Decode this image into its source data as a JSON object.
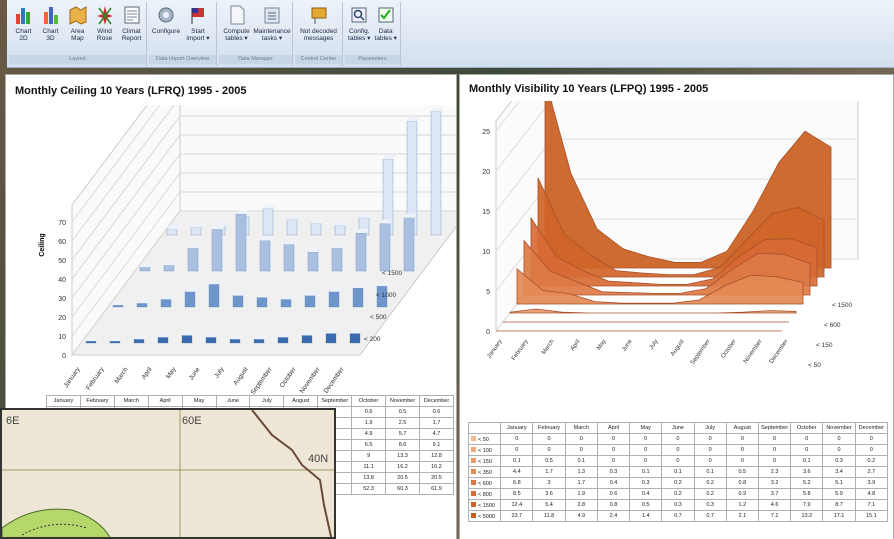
{
  "ribbon": {
    "groups": [
      {
        "caption": "Layout",
        "buttons": [
          "Chart\n2D",
          "Chart\n3D",
          "Area\nMap",
          "Wind\nRose",
          "Climat\nReport"
        ]
      },
      {
        "caption": "Data Import Overview",
        "buttons": [
          "Configure",
          "Start\nimport ▾"
        ]
      },
      {
        "caption": "Data Manager",
        "buttons": [
          "Compute\ntables ▾",
          "Maintenance\ntasks ▾"
        ]
      },
      {
        "caption": "Control Center",
        "buttons": [
          "Not decoded\nmessages"
        ]
      },
      {
        "caption": "Parameters",
        "buttons": [
          "Config.\ntables ▾",
          "Data\ntables ▾"
        ]
      }
    ]
  },
  "ceiling": {
    "title": "Monthly Ceiling 10 Years (LFRQ) 1995 - 2005",
    "ylabel": "Ceiling",
    "yticks": [
      "0",
      "10",
      "20",
      "30",
      "40",
      "50",
      "60",
      "70"
    ],
    "depth_labels": [
      "< 1500",
      "< 1000",
      "< 500",
      "< 200"
    ],
    "months": [
      "January",
      "February",
      "March",
      "April",
      "May",
      "June",
      "July",
      "August",
      "September",
      "October",
      "November",
      "December"
    ],
    "table_rows": [
      [
        "",
        "",
        "",
        "",
        "",
        "",
        "",
        "",
        "0.6",
        "0.5",
        "0.6"
      ],
      [
        "",
        "",
        "",
        "",
        "",
        "",
        "",
        "",
        "1.9",
        "2.5",
        "1.7"
      ],
      [
        "",
        "",
        "",
        "",
        "",
        "",
        "",
        "",
        "4.9",
        "5.7",
        "4.7"
      ],
      [
        "",
        "",
        "",
        "",
        "",
        "",
        "",
        "",
        "6.5",
        "8.6",
        "9.1"
      ],
      [
        "",
        "",
        "",
        "",
        "",
        "",
        "",
        "",
        "9",
        "13.3",
        "12.8"
      ],
      [
        "",
        "",
        "",
        "",
        "",
        "",
        "",
        "",
        "11.1",
        "16.2",
        "16.2"
      ],
      [
        "",
        "",
        "",
        "",
        "",
        "",
        "",
        "",
        "13.8",
        "20.5",
        "20.5"
      ],
      [
        "",
        "",
        "",
        "",
        "",
        "",
        "",
        "",
        "52.3",
        "60.3",
        "61.9"
      ]
    ]
  },
  "visibility": {
    "title": "Monthly Visibility 10 Years (LFPQ) 1995 - 2005",
    "yticks": [
      "0",
      "5",
      "10",
      "15",
      "20",
      "25"
    ],
    "depth_labels": [
      "< 1500",
      "< 600",
      "< 150",
      "< 50"
    ],
    "months": [
      "January",
      "February",
      "March",
      "April",
      "May",
      "June",
      "July",
      "August",
      "September",
      "October",
      "November",
      "December"
    ],
    "table_header": [
      "",
      "January",
      "February",
      "March",
      "April",
      "May",
      "June",
      "July",
      "August",
      "September",
      "October",
      "November",
      "December"
    ],
    "table_rows": [
      {
        "label": "< 50",
        "values": [
          "0",
          "0",
          "0",
          "0",
          "0",
          "0",
          "0",
          "0",
          "0",
          "0",
          "0",
          "0"
        ]
      },
      {
        "label": "< 100",
        "values": [
          "0",
          "0",
          "0",
          "0",
          "0",
          "0",
          "0",
          "0",
          "0",
          "0",
          "0",
          "0"
        ]
      },
      {
        "label": "< 150",
        "values": [
          "0.1",
          "0.5",
          "0.1",
          "0",
          "0",
          "0",
          "0",
          "0",
          "0",
          "0.1",
          "0.3",
          "0.2"
        ]
      },
      {
        "label": "< 350",
        "values": [
          "4.4",
          "1.7",
          "1.3",
          "0.3",
          "0.1",
          "0.1",
          "0.1",
          "0.5",
          "2.3",
          "3.6",
          "3.4",
          "2.7"
        ]
      },
      {
        "label": "< 600",
        "values": [
          "6.8",
          "3",
          "1.7",
          "0.4",
          "0.3",
          "0.2",
          "0.2",
          "0.8",
          "3.2",
          "5.2",
          "5.1",
          "3.9"
        ]
      },
      {
        "label": "< 800",
        "values": [
          "8.5",
          "3.6",
          "1.9",
          "0.6",
          "0.4",
          "0.2",
          "0.2",
          "0.9",
          "3.7",
          "5.8",
          "5.9",
          "4.8"
        ]
      },
      {
        "label": "< 1500",
        "values": [
          "12.4",
          "5.4",
          "2.8",
          "0.8",
          "0.5",
          "0.3",
          "0.3",
          "1.2",
          "4.6",
          "7.9",
          "8.7",
          "7.1"
        ]
      },
      {
        "label": "< 5000",
        "values": [
          "23.7",
          "11.8",
          "4.9",
          "2.4",
          "1.4",
          "0.7",
          "0.7",
          "2.1",
          "7.1",
          "13.2",
          "17.1",
          "15.1"
        ]
      }
    ],
    "row_colors": [
      "#f0b890",
      "#eeaa80",
      "#e89a6a",
      "#e48a55",
      "#dd7a45",
      "#d86a35",
      "#cf6528",
      "#c95e20"
    ]
  },
  "map": {
    "labels": [
      "6E",
      "60E",
      "40N"
    ]
  }
}
